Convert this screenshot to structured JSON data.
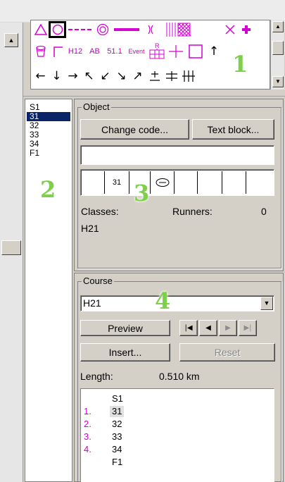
{
  "palette": {
    "row2_labels": [
      "H12",
      "AB",
      "51.1",
      "Event"
    ],
    "row3_arrows": [
      "←",
      "↓",
      "→",
      "↖",
      "↙",
      "↘",
      "↗"
    ],
    "accent": "#d400d4"
  },
  "controls": {
    "items": [
      "S1",
      "31",
      "32",
      "33",
      "34",
      "F1"
    ],
    "selected": "31"
  },
  "annotations": {
    "a1": "1",
    "a2": "2",
    "a3": "3",
    "a4": "4"
  },
  "object_panel": {
    "title": "Object",
    "change_code_label": "Change code...",
    "text_block_label": "Text block...",
    "text_field_value": "",
    "code_value": "31",
    "classes_label": "Classes:",
    "classes_value": "H21",
    "runners_label": "Runners:",
    "runners_value": "0"
  },
  "course_panel": {
    "title": "Course",
    "selected_course": "H21",
    "preview_label": "Preview",
    "insert_label": "Insert...",
    "reset_label": "Reset",
    "length_label": "Length:",
    "length_value": "0.510 km",
    "legs": [
      {
        "num": "",
        "code": "S1"
      },
      {
        "num": "1.",
        "code": "31"
      },
      {
        "num": "2.",
        "code": "32"
      },
      {
        "num": "3.",
        "code": "33"
      },
      {
        "num": "4.",
        "code": "34"
      },
      {
        "num": "",
        "code": "F1"
      }
    ]
  }
}
